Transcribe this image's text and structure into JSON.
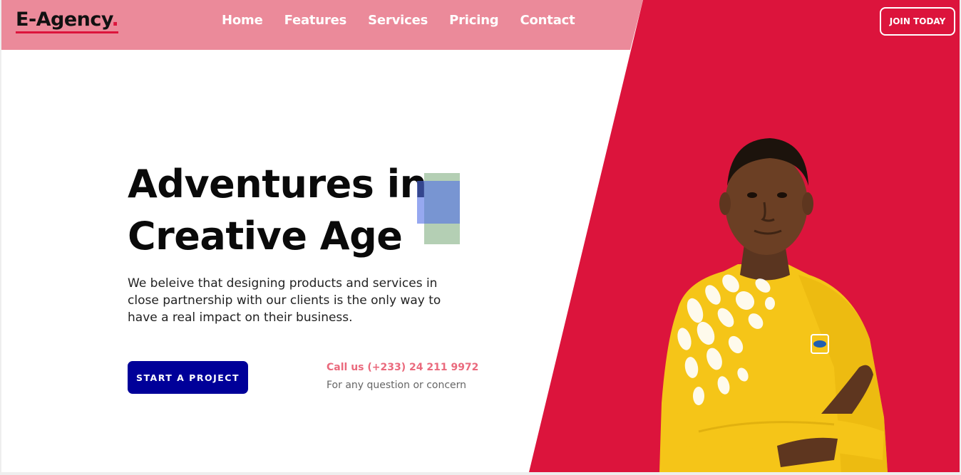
{
  "brand": {
    "name": "E-Agency",
    "dot": ".",
    "accent": "#dc143c",
    "nav_bg": "#eb8a9a"
  },
  "nav": {
    "items": [
      {
        "label": "Home"
      },
      {
        "label": "Features"
      },
      {
        "label": "Services"
      },
      {
        "label": "Pricing"
      },
      {
        "label": "Contact"
      }
    ],
    "join_label": "JOIN TODAY"
  },
  "hero": {
    "title_line1": "Adventures in",
    "title_line2": "Creative Age",
    "description": "We beleive that designing products and services in close partnership with our clients is the only way to have a real impact on their business.",
    "cta_label": "START A PROJECT",
    "cta_color": "#000099",
    "call_text": "Call us (+233) 24 211 9972",
    "call_sub": "For any question or concern"
  },
  "person_image": {
    "icon": "person-photo",
    "shirt_color": "#f5c518",
    "badge_text": "MTN"
  }
}
